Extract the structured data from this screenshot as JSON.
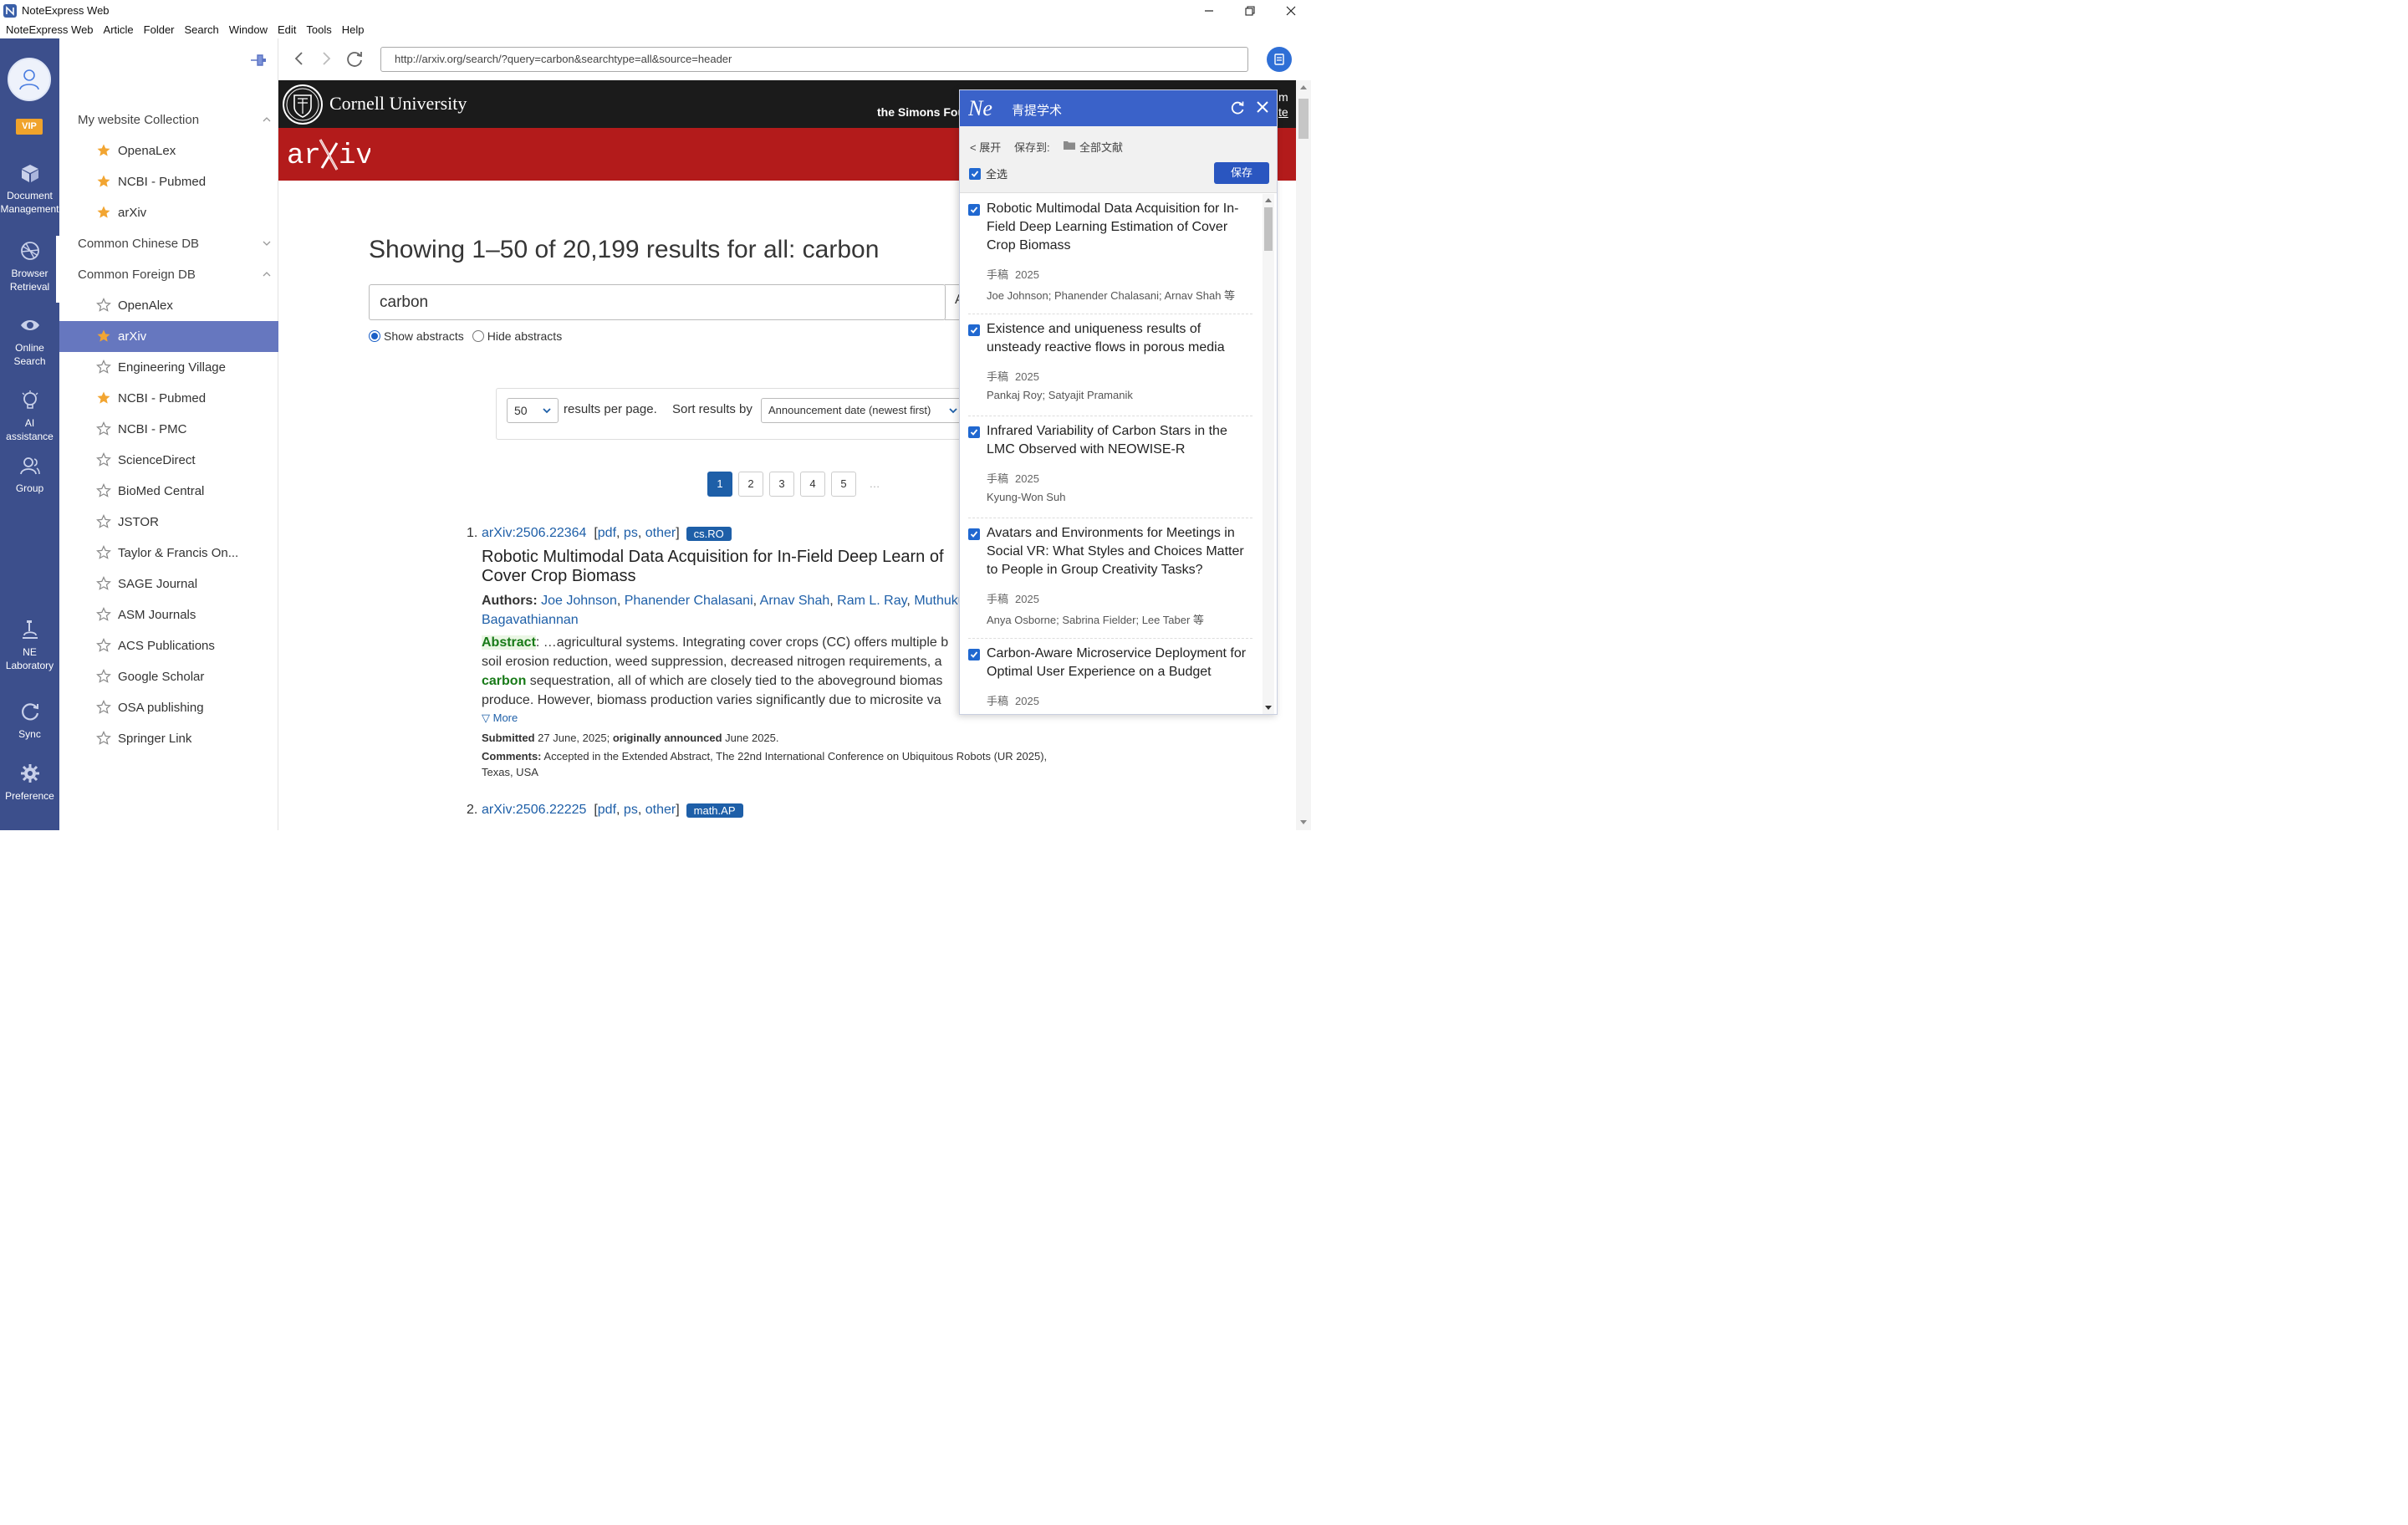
{
  "window": {
    "title": "NoteExpress Web"
  },
  "menu": [
    "NoteExpress Web",
    "Article",
    "Folder",
    "Search",
    "Window",
    "Edit",
    "Tools",
    "Help"
  ],
  "rail": {
    "vip": "VIP",
    "items": [
      {
        "label_1": "Document",
        "label_2": "Management"
      },
      {
        "label_1": "Browser",
        "label_2": "Retrieval"
      },
      {
        "label_1": "Online",
        "label_2": "Search"
      },
      {
        "label_1": "AI assistance",
        "label_2": ""
      },
      {
        "label_1": "Group",
        "label_2": ""
      },
      {
        "label_1": "NE",
        "label_2": "Laboratory"
      },
      {
        "label_1": "Sync",
        "label_2": ""
      },
      {
        "label_1": "Preference",
        "label_2": ""
      }
    ]
  },
  "sidebar": {
    "groups": [
      {
        "title": "My website Collection",
        "expanded": true
      },
      {
        "title": "Common Chinese DB",
        "expanded": false
      },
      {
        "title": "Common Foreign DB",
        "expanded": true
      }
    ],
    "website_items": [
      {
        "label": "OpenaLex",
        "starred": true
      },
      {
        "label": "NCBI - Pubmed",
        "starred": true
      },
      {
        "label": "arXiv",
        "starred": true
      }
    ],
    "foreign_items": [
      {
        "label": "OpenAlex",
        "starred": false
      },
      {
        "label": "arXiv",
        "starred": true,
        "active": true
      },
      {
        "label": "Engineering Village",
        "starred": false
      },
      {
        "label": "NCBI - Pubmed",
        "starred": true
      },
      {
        "label": "NCBI - PMC",
        "starred": false
      },
      {
        "label": "ScienceDirect",
        "starred": false
      },
      {
        "label": "BioMed Central",
        "starred": false
      },
      {
        "label": "JSTOR",
        "starred": false
      },
      {
        "label": "Taylor & Francis On...",
        "starred": false
      },
      {
        "label": "SAGE Journal",
        "starred": false
      },
      {
        "label": "ASM Journals",
        "starred": false
      },
      {
        "label": "ACS Publications",
        "starred": false
      },
      {
        "label": "Google Scholar",
        "starred": false
      },
      {
        "label": "OSA publishing",
        "starred": false
      },
      {
        "label": "Springer Link",
        "starred": false
      }
    ]
  },
  "browser": {
    "url": "http://arxiv.org/search/?query=carbon&searchtype=all&source=header"
  },
  "page": {
    "cornell": "Cornell University",
    "simons": "the Simons Fou",
    "edge_top": "m",
    "edge_link": "te",
    "heading": "Showing 1–50 of 20,199 results for all: carbon",
    "query": "carbon",
    "search_box_overflow": "A",
    "show_abstracts": "Show abstracts",
    "hide_abstracts": "Hide abstracts",
    "per_page_value": "50",
    "per_page_text": "results per page.",
    "sort_label": "Sort results by",
    "sort_value": "Announcement date (newest first)",
    "pages": [
      "1",
      "2",
      "3",
      "4",
      "5"
    ],
    "current_page": "1",
    "ellipsis": "…",
    "results": [
      {
        "num": "1.",
        "id": "arXiv:2506.22364",
        "links": [
          "pdf",
          "ps",
          "other"
        ],
        "tag": "cs.RO",
        "title": "Robotic Multimodal Data Acquisition for In-Field Deep Learn of Cover Crop Biomass",
        "authors_label": "Authors:",
        "authors": [
          "Joe Johnson",
          "Phanender Chalasani",
          "Arnav Shah",
          "Ram L. Ray",
          "Muthuku"
        ],
        "authors_line2": "Bagavathiannan",
        "abstract_label": "Abstract",
        "abstract_1": "…agricultural systems. Integrating cover crops (CC) offers multiple b",
        "abstract_2": "soil erosion reduction, weed suppression, decreased nitrogen requirements, a",
        "abstract_hl": "carbon",
        "abstract_3": " sequestration, all of which are closely tied to the aboveground biomas",
        "abstract_4": "produce. However, biomass production varies significantly due to microsite va",
        "more": "▽ More",
        "submitted_label": "Submitted",
        "submitted": " 27 June, 2025; ",
        "announced_label": "originally announced",
        "announced": " June 2025.",
        "comments_label": "Comments:",
        "comments": " Accepted in the Extended Abstract, The 22nd International Conference on Ubiquitous Robots (UR 2025), Texas, USA"
      },
      {
        "num": "2.",
        "id": "arXiv:2506.22225",
        "links": [
          "pdf",
          "ps",
          "other"
        ],
        "tag": "math.AP"
      }
    ]
  },
  "ne_panel": {
    "title": "青提学术",
    "expand": "< 展开",
    "save_to": "保存到:",
    "folder": "全部文献",
    "select_all": "全选",
    "save": "保存",
    "items": [
      {
        "title": "Robotic Multimodal Data Acquisition for In-Field Deep Learning Estimation of Cover Crop Biomass",
        "type": "手稿",
        "year": "2025",
        "authors": "Joe Johnson; Phanender Chalasani; Arnav Shah 等"
      },
      {
        "title": "Existence and uniqueness results of unsteady reactive flows in porous media",
        "type": "手稿",
        "year": "2025",
        "authors": "Pankaj Roy; Satyajit Pramanik"
      },
      {
        "title": "Infrared Variability of Carbon Stars in the LMC Observed with NEOWISE-R",
        "type": "手稿",
        "year": "2025",
        "authors": "Kyung-Won Suh"
      },
      {
        "title": "Avatars and Environments for Meetings in Social VR: What Styles and Choices Matter to People in Group Creativity Tasks?",
        "type": "手稿",
        "year": "2025",
        "authors": "Anya Osborne; Sabrina Fielder; Lee Taber 等"
      },
      {
        "title": "Carbon-Aware Microservice Deployment for Optimal User Experience on a Budget",
        "type": "手稿",
        "year": "2025",
        "authors": ""
      }
    ]
  },
  "colors": {
    "rail": "#3c4f8c",
    "active_item": "#6677bf",
    "arxiv_red": "#b31b1b",
    "link": "#1e5fa8",
    "ne_header": "#3a62c9"
  }
}
